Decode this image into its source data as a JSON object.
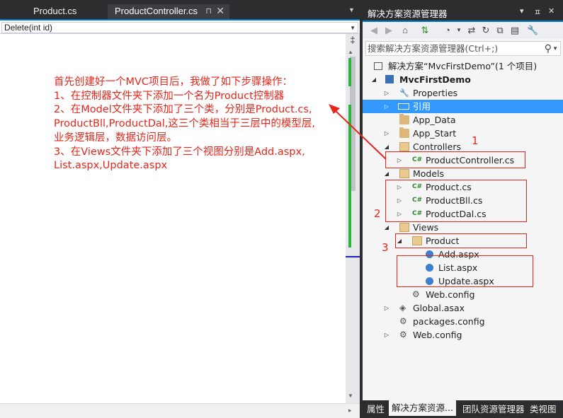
{
  "editor": {
    "tabs": [
      {
        "label": "Product.cs"
      },
      {
        "label": "ProductController.cs",
        "pin": "⊓",
        "close": "✕"
      }
    ],
    "member_dropdown": "Delete(int id)",
    "annotation_lines": [
      "首先创建好一个MVC项目后，我做了如下步骤操作：",
      "1、在控制器文件夹下添加一个名为Product控制器",
      "2、在Model文件夹下添加了三个类，分别是Product.cs,",
      "ProductBll,ProductDal,这三个类相当于三层中的模型层,",
      "业务逻辑层，数据访问层。",
      "3、在Views文件夹下添加了三个视图分别是Add.aspx,",
      "List.aspx,Update.aspx"
    ]
  },
  "solution_explorer": {
    "title": "解决方案资源管理器",
    "search_placeholder": "搜索解决方案资源管理器(Ctrl+;)",
    "tree": [
      {
        "label": "解决方案“MvcFirstDemo”(1 个项目)"
      },
      {
        "label": "MvcFirstDemo"
      },
      {
        "label": "Properties"
      },
      {
        "label": "引用"
      },
      {
        "label": "App_Data"
      },
      {
        "label": "App_Start"
      },
      {
        "label": "Controllers"
      },
      {
        "label": "ProductController.cs"
      },
      {
        "label": "Models"
      },
      {
        "label": "Product.cs"
      },
      {
        "label": "ProductBll.cs"
      },
      {
        "label": "ProductDal.cs"
      },
      {
        "label": "Views"
      },
      {
        "label": "Product"
      },
      {
        "label": "Add.aspx"
      },
      {
        "label": "List.aspx"
      },
      {
        "label": "Update.aspx"
      },
      {
        "label": "Web.config"
      },
      {
        "label": "Global.asax"
      },
      {
        "label": "packages.config"
      },
      {
        "label": "Web.config"
      }
    ],
    "callout_numbers": [
      "1",
      "2",
      "3"
    ],
    "bottom_tabs": [
      {
        "label": "属性"
      },
      {
        "label": "解决方案资源..."
      },
      {
        "label": "团队资源管理器"
      },
      {
        "label": "类视图"
      }
    ],
    "selected_item": "引用"
  },
  "colors": {
    "accent": "#007acc",
    "selection": "#3399ff",
    "annotation_red": "#e8251a",
    "change_green": "#2db53b"
  }
}
